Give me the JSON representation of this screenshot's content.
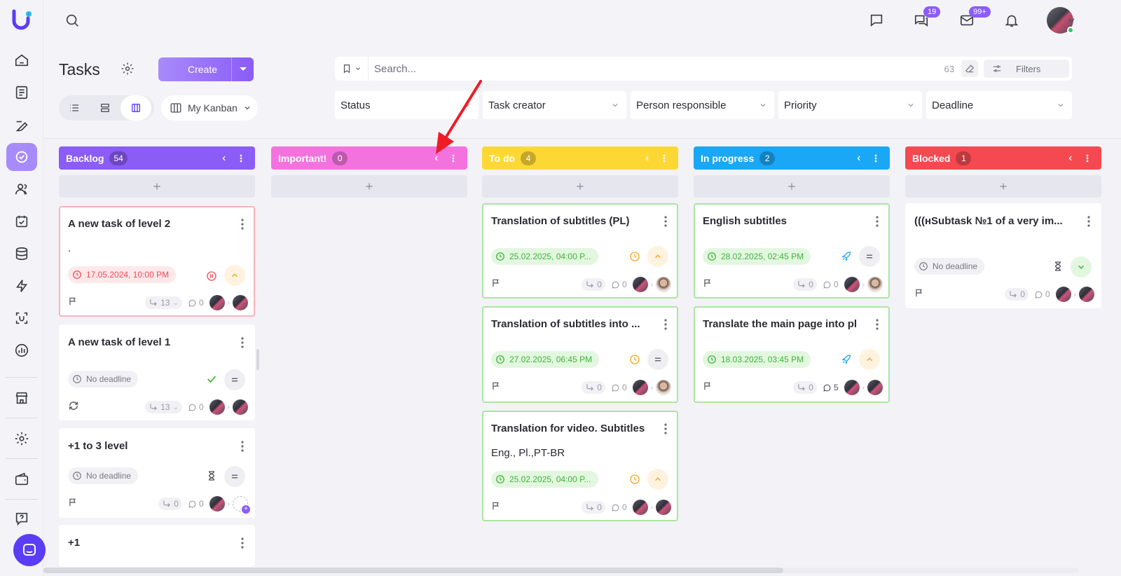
{
  "header": {
    "messages_badge": "19",
    "mail_badge": "99+"
  },
  "toolbar": {
    "title": "Tasks",
    "create_label": "Create",
    "view_name": "My Kanban",
    "search_placeholder": "Search...",
    "result_count": "63",
    "filters_label": "Filters",
    "filters": [
      "Status",
      "Task creator",
      "Person responsible",
      "Priority",
      "Deadline"
    ]
  },
  "colors": {
    "backlog": "#8b5cf6",
    "important": "#f472de",
    "todo": "#fdd835",
    "in_progress": "#1aa7f5",
    "blocked": "#f44950",
    "accent": "#8b5cf6"
  },
  "columns": [
    {
      "title": "Backlog",
      "count": "54",
      "cards": [
        {
          "title": "A new task of level 2",
          "desc": ".",
          "deadline": "17.05.2024, 10:00 PM",
          "subtasks": "13",
          "comments": "0"
        },
        {
          "title": "A new task of level 1",
          "deadline": "No deadline",
          "subtasks": "13",
          "comments": "0"
        },
        {
          "title": "+1 to 3 level",
          "deadline": "No deadline",
          "subtasks": "0",
          "comments": "0"
        },
        {
          "title": "+1"
        }
      ]
    },
    {
      "title": "Important!",
      "count": "0",
      "cards": []
    },
    {
      "title": "To do",
      "count": "4",
      "cards": [
        {
          "title": "Translation of subtitles (PL)",
          "deadline": "25.02.2025, 04:00 P...",
          "subtasks": "0",
          "comments": "0"
        },
        {
          "title": "Translation of subtitles into ...",
          "deadline": "27.02.2025, 06:45 PM",
          "subtasks": "0",
          "comments": "0"
        },
        {
          "title": "Translation for video. Subtitles",
          "desc": "Eng., Pl.,PT-BR",
          "deadline": "25.02.2025, 04:00 P...",
          "subtasks": "0",
          "comments": "0"
        }
      ]
    },
    {
      "title": "In progress",
      "count": "2",
      "cards": [
        {
          "title": "English subtitles",
          "deadline": "28.02.2025, 02:45 PM",
          "subtasks": "0",
          "comments": "0"
        },
        {
          "title": "Translate the main page into pl",
          "deadline": "18.03.2025, 03:45 PM",
          "subtasks": "0",
          "comments": "5"
        }
      ]
    },
    {
      "title": "Blocked",
      "count": "1",
      "cards": [
        {
          "title": "(((нSubtask №1 of a very im...",
          "deadline": "No deadline",
          "subtasks": "0",
          "comments": "0"
        }
      ]
    }
  ],
  "icons": [
    "search-icon",
    "chat-icon",
    "messages-icon",
    "mail-icon",
    "bell-icon",
    "gear-icon",
    "flag-icon",
    "clock-icon",
    "subtask-icon",
    "comment-icon",
    "kebab-icon",
    "chevron-left-icon",
    "plus-icon",
    "rocket-icon",
    "hourglass-icon",
    "check-icon",
    "pause-icon",
    "repeat-icon"
  ]
}
